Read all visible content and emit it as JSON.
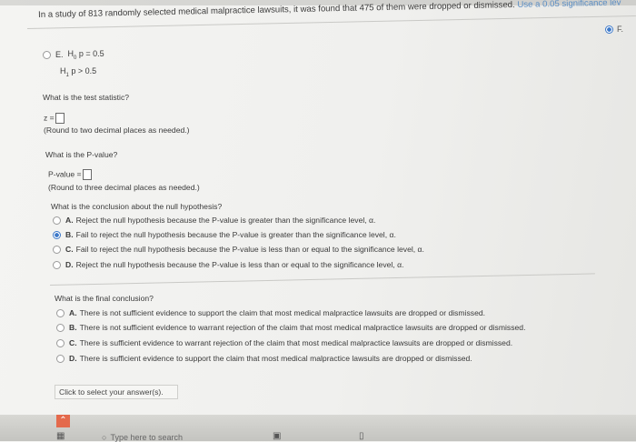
{
  "question": {
    "text": "In a study of 813 randomly selected medical malpractice lawsuits, it was found that 475 of them were dropped or dismissed.",
    "tail": "Use a 0.05 significance lev"
  },
  "corner_option": {
    "label": "F."
  },
  "hypotheses": {
    "option_label": "E.",
    "h0_symbol": "H",
    "h0_sub": "0",
    "h0_rel": "p = 0.5",
    "h1_symbol": "H",
    "h1_sub": "1",
    "h1_rel": "p > 0.5"
  },
  "test_stat": {
    "question": "What is the test statistic?",
    "prefix": "z =",
    "hint": "(Round to two decimal places as needed.)"
  },
  "pvalue": {
    "question": "What is the P-value?",
    "prefix": "P-value =",
    "hint": "(Round to three decimal places as needed.)"
  },
  "null_conclusion": {
    "question": "What is the conclusion about the null hypothesis?",
    "options": [
      {
        "label": "A.",
        "text": "Reject the null hypothesis because the P-value is greater than the significance level, α.",
        "selected": false
      },
      {
        "label": "B.",
        "text": "Fail to reject the null hypothesis because the P-value is greater than the significance level, α.",
        "selected": true
      },
      {
        "label": "C.",
        "text": "Fail to reject the null hypothesis because the P-value is less than or equal to the significance level, α.",
        "selected": false
      },
      {
        "label": "D.",
        "text": "Reject the null hypothesis because the P-value is less than or equal to the significance level, α.",
        "selected": false
      }
    ]
  },
  "final_conclusion": {
    "question": "What is the final conclusion?",
    "options": [
      {
        "label": "A.",
        "text": "There is not sufficient evidence to support the claim that most medical malpractice lawsuits are dropped or dismissed."
      },
      {
        "label": "B.",
        "text": "There is not sufficient evidence to warrant rejection of the claim that most medical malpractice lawsuits are dropped or dismissed."
      },
      {
        "label": "C.",
        "text": "There is sufficient evidence to warrant rejection of the claim that most medical malpractice lawsuits are dropped or dismissed."
      },
      {
        "label": "D.",
        "text": "There is sufficient evidence to support the claim that most medical malpractice lawsuits are dropped or dismissed."
      }
    ]
  },
  "select_answer": "Click to select your answer(s).",
  "taskbar": {
    "search_placeholder": "Type here to search"
  },
  "colors": {
    "accent": "#3d79c9",
    "highlight": "#5b8ec4",
    "start": "#e46a4c"
  }
}
